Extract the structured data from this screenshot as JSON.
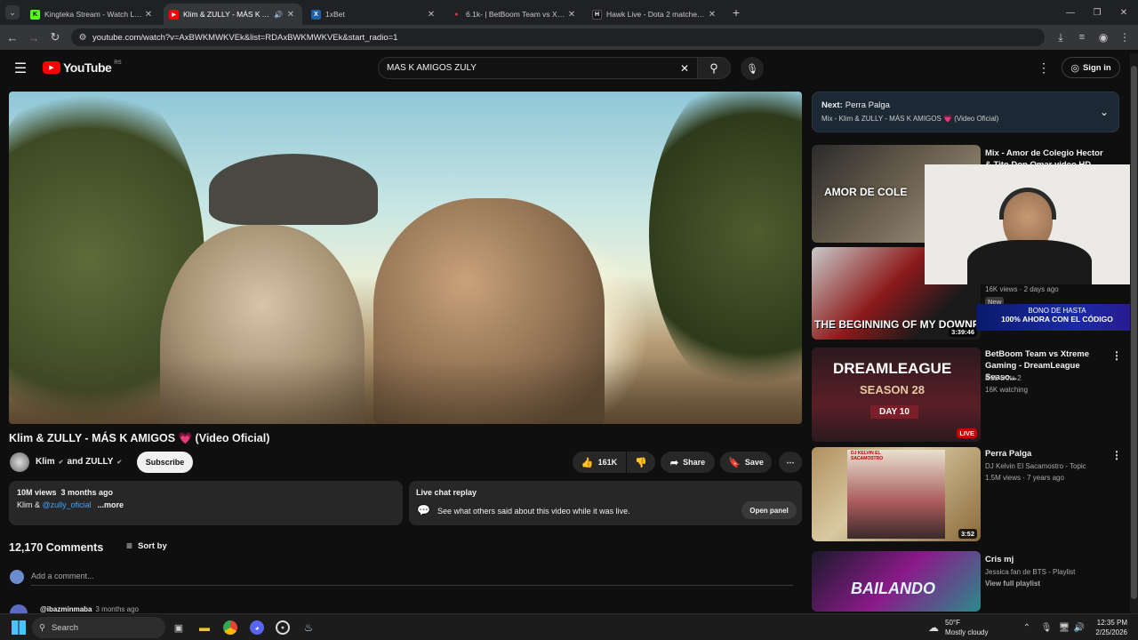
{
  "browser": {
    "tabs": [
      {
        "title": "Kingteka Stream - Watch Live o",
        "favicon": "K",
        "color": "#53fc18"
      },
      {
        "title": "Klim & ZULLY - MÁS K AMIG",
        "favicon": "▶",
        "color": "#ff0000"
      },
      {
        "title": "1xBet",
        "favicon": "X",
        "color": "#1a5fa8"
      },
      {
        "title": "6.1k- | BetBoom Team vs Xtrem",
        "favicon": "●",
        "color": "#e53935"
      },
      {
        "title": "Hawk Live - Dota 2 matches liv",
        "favicon": "H",
        "color": "#111"
      }
    ],
    "url": "youtube.com/watch?v=AxBWKMWKVEk&list=RDAxBWKMWKVEk&start_radio=1"
  },
  "youtube": {
    "logo_text": "YouTube",
    "region": "RS",
    "search_value": "MAS K AMIGOS ZULY",
    "signin_label": "Sign in"
  },
  "video": {
    "title": "Klim & ZULLY - MÁS K AMIGOS 💗 (Video Oficial)",
    "channel": "Klim",
    "and_text": "and ZULLY",
    "subscribe_label": "Subscribe",
    "likes": "161K",
    "share_label": "Share",
    "save_label": "Save",
    "views": "10M views  3 months ago",
    "desc_prefix": "Klim & ",
    "desc_link": "@zully_oficial",
    "more": "...more",
    "chat_title": "Live chat replay",
    "chat_text": "See what others said about this video while it was live.",
    "open_panel": "Open panel"
  },
  "comments": {
    "count": "12,170 Comments",
    "sort_label": "Sort by",
    "add_placeholder": "Add a comment...",
    "first_user": "@ibazminmaba",
    "first_time": "3 months ago"
  },
  "sidebar": {
    "next_label": "Next:",
    "next_title": "Perra Palga",
    "next_sub": "Mix - Klim & ZULLY - MÁS K AMIGOS 💗 (Video Oficial)",
    "items": [
      {
        "title": "Mix - Amor de Colegio Hector & Tito Don Omar video HD",
        "meta1": "",
        "meta2": "",
        "thumb_text": "AMOR DE COLE",
        "duration": ""
      },
      {
        "title": "",
        "meta1": "16K views · 2 days ago",
        "meta2": "New",
        "thumb_text": "THE BEGINNING OF MY DOWNFALL",
        "duration": "3:39:46"
      },
      {
        "title": "BetBoom Team vs Xtreme Gaming - DreamLeague Seaso...",
        "meta1": "ESL Dota 2",
        "meta2": "16K watching",
        "thumb_text": "DREAMLEAGUE",
        "duration": "LIVE"
      },
      {
        "title": "Perra Palga",
        "meta1": "DJ Kelvin El Sacamostro - Topic",
        "meta2": "1.5M views · 7 years ago",
        "thumb_text": "DJ KELVIN EL SACAMOSTRO",
        "duration": "3:52"
      },
      {
        "title": "Cris mj",
        "meta1": "Jessica fan de BTS - Playlist",
        "meta2": "View full playlist",
        "thumb_text": "BAILANDO",
        "duration": ""
      }
    ],
    "thumb_sub": [
      "SEASON 28",
      "DAY 10"
    ]
  },
  "overlay": {
    "banner_line1": "BONO DE HASTA",
    "banner_line2": "100% AHORA CON EL CÓDIGO"
  },
  "taskbar": {
    "search_label": "Search",
    "weather_temp": "50°F",
    "weather_desc": "Mostly cloudy",
    "time": "12:35 PM",
    "date": "2/25/2026"
  }
}
